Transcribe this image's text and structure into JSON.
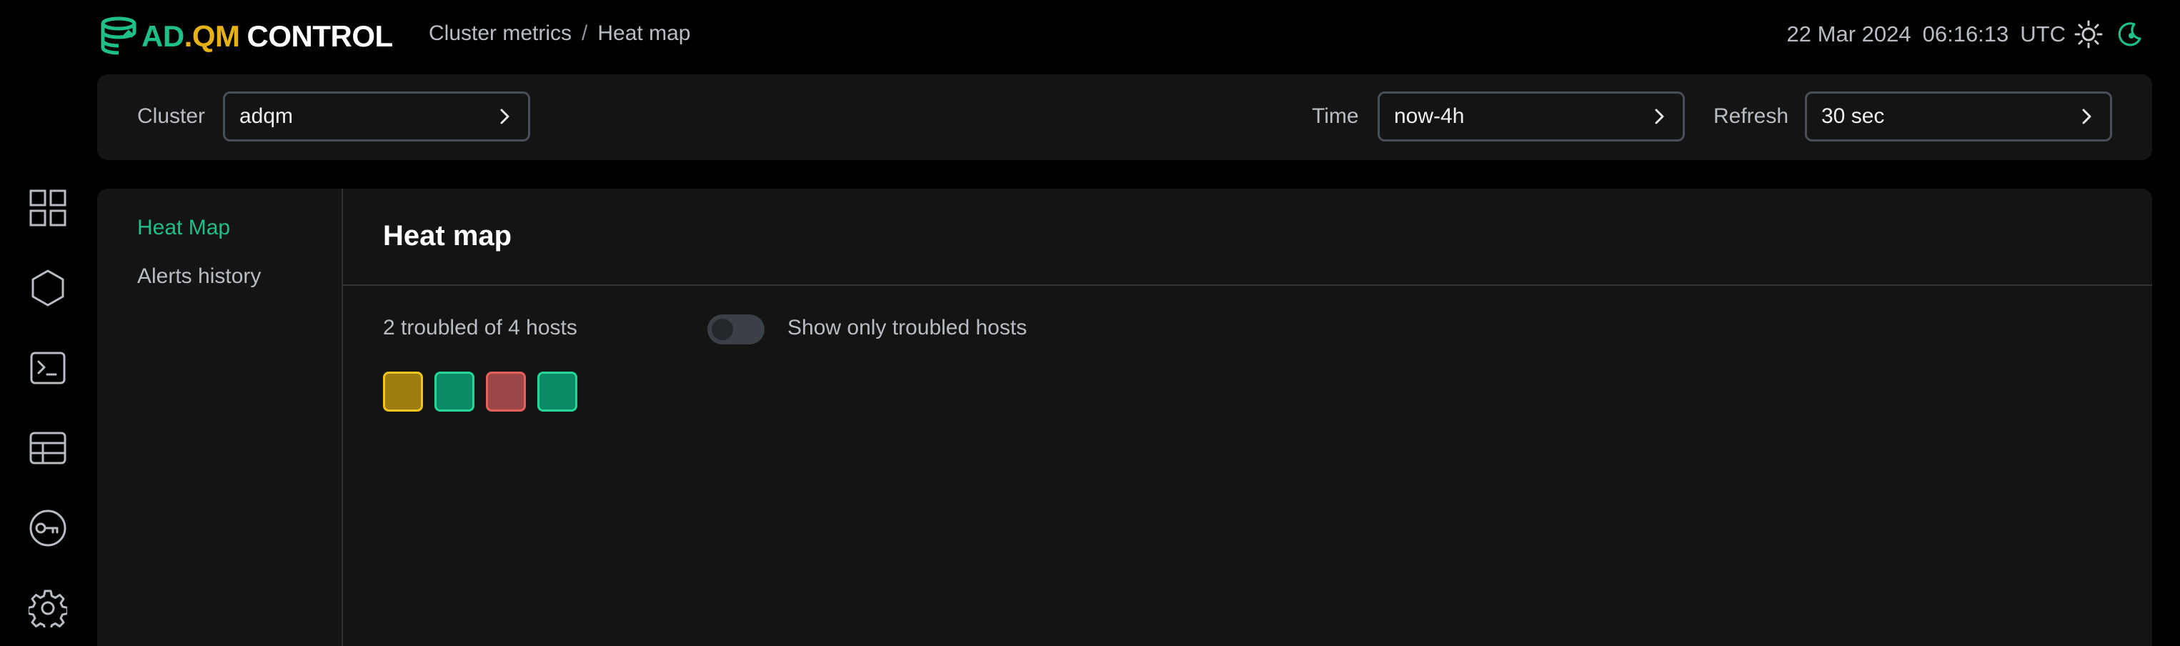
{
  "app": {
    "logo_ad": "AD",
    "logo_qm": ".QM",
    "logo_control": "CONTROL",
    "colors": {
      "accent": "#1fbf8a",
      "logo_yellow": "#e6b115",
      "background": "#000000",
      "panel": "#141414"
    }
  },
  "breadcrumb": {
    "section": "Cluster metrics",
    "separator": "/",
    "page": "Heat map"
  },
  "clock": {
    "date": "22 Mar 2024",
    "time": "06:16:13",
    "tz": "UTC"
  },
  "theme_icons": [
    "sun-icon",
    "moon-icon"
  ],
  "filters": {
    "cluster_label": "Cluster",
    "cluster_value": "adqm",
    "time_label": "Time",
    "time_value": "now-4h",
    "refresh_label": "Refresh",
    "refresh_value": "30 sec"
  },
  "rail_icons": [
    "dashboard-icon",
    "hexagon-icon",
    "terminal-icon",
    "table-icon",
    "key-icon",
    "settings-icon"
  ],
  "subnav": [
    {
      "label": "Heat Map",
      "active": true
    },
    {
      "label": "Alerts history",
      "active": false
    }
  ],
  "content": {
    "title": "Heat map",
    "summary": "2 troubled of 4 hosts",
    "toggle_label": "Show only troubled hosts",
    "toggle_on": false
  },
  "hosts": [
    {
      "status": "warning",
      "color": "#9c7c0e"
    },
    {
      "status": "ok",
      "color": "#0b8a66"
    },
    {
      "status": "critical",
      "color": "#9c4747"
    },
    {
      "status": "ok",
      "color": "#0b8a66"
    }
  ]
}
